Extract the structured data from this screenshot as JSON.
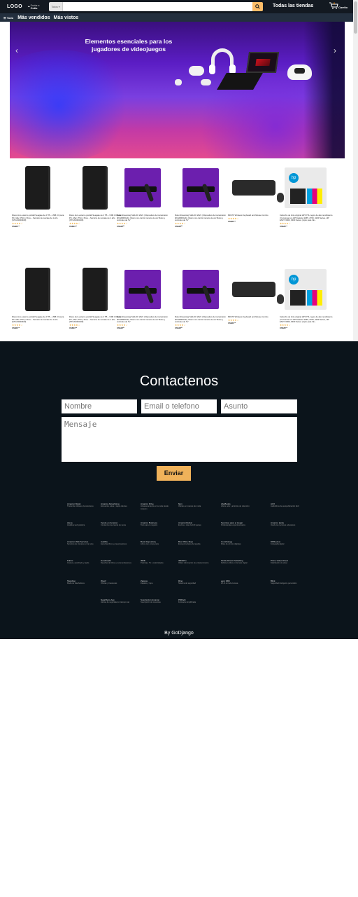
{
  "navbar": {
    "logo": "LOGO",
    "deliver_line1": "Enviar a",
    "deliver_line2": "Cetis",
    "category": "Todos",
    "search_placeholder": "",
    "all_stores": "Todas las tiendas",
    "cart_count": "0",
    "cart_label": "Carrito"
  },
  "subnav": {
    "all": "Todo",
    "links": [
      "Más vendidos",
      "Más vistos"
    ]
  },
  "banner": {
    "headline": "Elementos esenciales para los jugadores de videojuegos"
  },
  "products": [
    {
      "title": "Disco duro externo portátil Seagate de 2 TB – USB 3.0 para PC, Mac, PS4 y Xbox – Servicio de rescate de 1 año (STGX2000400)",
      "stars": "★★★★☆",
      "price": "US$64⁹⁹"
    },
    {
      "title": "Disco duro externo portátil Seagate de 2 TB – USB 3.0 para PC, Mac, PS4 y Xbox – Servicio de rescate de 1 año (STGX2000400)",
      "stars": "★★★★☆",
      "price": "US$64⁹⁹"
    },
    {
      "title": "Roku Streaming Stick 4K 2021 | Dispositivo de transmisión 4K/HDR/Dolby Vision con control remoto de voz Roku y controles de TV",
      "stars": "★★★★☆",
      "price": "US$49⁰⁰"
    },
    {
      "title": "Roku Streaming Stick 4K 2021 | Dispositivo de transmisión 4K/HDR/Dolby Vision con control remoto de voz Roku y controles de TV",
      "stars": "★★★★☆",
      "price": "US$49⁰⁰"
    },
    {
      "title": "MK270 Wireless Keyboard and Mouse Combo",
      "stars": "★★★★☆",
      "price": "US$24⁹⁹"
    },
    {
      "title": "Cartucho de tinta original HP 67XL negro de alto rendimiento | Funciona con HP DeskJet 1255, 2700, 4100 Series, HP ENVY 6000, 6400 Series | Apto para Ink...",
      "stars": "★★★★☆",
      "price": "US$35⁹⁹"
    },
    {
      "title": "Disco duro externo portátil Seagate de 2 TB – USB 3.0 para PC, Mac, PS4 y Xbox – Servicio de rescate de 1 año (STGX2000400)",
      "stars": "★★★★☆",
      "price": "US$64⁹⁹"
    },
    {
      "title": "Disco duro externo portátil Seagate de 2 TB – USB 3.0 para PC, Mac, PS4 y Xbox – Servicio de rescate de 1 año (STGX2000400)",
      "stars": "★★★★☆",
      "price": "US$64⁹⁹"
    },
    {
      "title": "Roku Streaming Stick 4K 2021 | Dispositivo de transmisión 4K/HDR/Dolby Vision con control remoto de voz Roku y controles de TV",
      "stars": "★★★★☆",
      "price": "US$49⁰⁰"
    },
    {
      "title": "Roku Streaming Stick 4K 2021 | Dispositivo de transmisión 4K/HDR/Dolby Vision con control remoto de voz Roku y controles de TV",
      "stars": "★★★★☆",
      "price": "US$49⁰⁰"
    },
    {
      "title": "MK270 Wireless Keyboard and Mouse Combo",
      "stars": "★★★★☆",
      "price": "US$24⁹⁹"
    },
    {
      "title": "Cartucho de tinta original HP 67XL negro de alto rendimiento | Funciona con HP DeskJet 1255, 2700, 4100 Series, HP ENVY 6000, 6400 Series | Apto para Ink...",
      "stars": "★★★★☆",
      "price": "US$35⁹⁹"
    }
  ],
  "contact": {
    "title": "Contactenos",
    "name_placeholder": "Nombre",
    "email_placeholder": "Email o telefono",
    "subject_placeholder": "Asunto",
    "message_placeholder": "Mensaje",
    "send": "Enviar"
  },
  "footer_links": [
    {
      "h": "Amazon Music",
      "d": "Transmite millones de canciones"
    },
    {
      "h": "Amazon Advertising",
      "d": "Encuentra, atrae y capta clientes"
    },
    {
      "h": "Amazon Drive",
      "d": "Almacenamiento en la nube desde Amazon"
    },
    {
      "h": "6pm",
      "d": "Ofertas en marcas de moda"
    },
    {
      "h": "AbeBooks",
      "d": "Libros, arte y artículos de colección"
    },
    {
      "h": "ACX",
      "d": "Audiolibros de autopublicación fácil"
    },
    {
      "h": "Alexa",
      "d": "Analítica web práctica"
    },
    {
      "h": "Vende en Amazon",
      "d": "Comienza una cuenta de venta"
    },
    {
      "h": "Amazon Business",
      "d": "Todo para tu negocio"
    },
    {
      "h": "AmazonGlobal",
      "d": "Envíos a más de 100 países"
    },
    {
      "h": "Servicios para el Hogar",
      "d": "Profesionales experimentados"
    },
    {
      "h": "Amazon Ignite",
      "d": "Vende tus recursos educativos"
    },
    {
      "h": "Amazon Web Services",
      "d": "Servicios de cómputo en la nube"
    },
    {
      "h": "Audible",
      "d": "Escucha libros y presentaciones"
    },
    {
      "h": "Book Depository",
      "d": "Libros con envío gratis"
    },
    {
      "h": "Box Office Mojo",
      "d": "Encuentra datos de taquilla"
    },
    {
      "h": "ComiXology",
      "d": "Miles de cómics digitales"
    },
    {
      "h": "DPReview",
      "d": "Fotografía digital"
    },
    {
      "h": "Fabric",
      "d": "Costura, acolchado y tejido"
    },
    {
      "h": "Goodreads",
      "d": "Reseñas de libros y recomendaciones"
    },
    {
      "h": "IMDb",
      "d": "Películas, TV y celebridades"
    },
    {
      "h": "IMDbPro",
      "d": "Obtén información de entretenimiento"
    },
    {
      "h": "Kindle Direct Publishing",
      "d": "Publica tu libro en formato digital"
    },
    {
      "h": "Prime Video Direct",
      "d": "Distribución de video"
    },
    {
      "h": "Shopbop",
      "d": "Moda de diseñadores"
    },
    {
      "h": "Woot!",
      "d": "Ofertas y travesuras"
    },
    {
      "h": "Zappos",
      "d": "Zapatos y ropa"
    },
    {
      "h": "Ring",
      "d": "Sistema de seguridad"
    },
    {
      "h": "eero WiFi",
      "d": "Wi-Fi en toda la casa"
    },
    {
      "h": "Blink",
      "d": "Seguridad inteligente para todos"
    },
    {
      "h": "Neighbors App",
      "d": "Alertas de seguridad en tiempo real"
    },
    {
      "h": "Suscripción Amazon",
      "d": "Suscripción de mascotas"
    },
    {
      "h": "PillPack",
      "d": "Farmacia simplificada"
    }
  ],
  "byline": "By GoDjango"
}
